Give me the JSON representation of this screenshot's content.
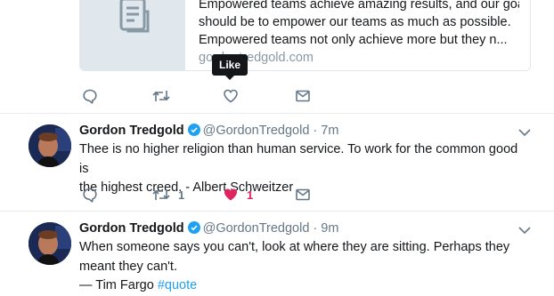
{
  "link_card": {
    "lines": [
      "Empowered teams achieve amazing results, and our goal",
      "should be to empower our teams as much as possible.",
      "Empowered teams not only achieve more but they n..."
    ],
    "domain": "gordontredgold.com",
    "thumb_icon": "document-icon"
  },
  "tooltip": {
    "label": "Like"
  },
  "tweets": [
    {
      "name": "Gordon Tredgold",
      "handle": "@GordonTredgold",
      "dot": "·",
      "time": "7m",
      "lines": [
        "Thee is no higher religion than human service. To work for the common good is",
        "the highest creed. -  Albert Schweitzer"
      ],
      "retweets": "1",
      "likes": "1"
    },
    {
      "name": "Gordon Tredgold",
      "handle": "@GordonTredgold",
      "dot": "·",
      "time": "9m",
      "lines": [
        "When someone says you can't, look at where they are sitting. Perhaps they",
        "meant they can't."
      ],
      "attribution": "— Tim Fargo ",
      "hashtag": "#quote"
    }
  ],
  "colors": {
    "icon_gray": "#657786",
    "like_red": "#e0245e",
    "verified_blue": "#1da1f2",
    "link_blue": "#1da1f2",
    "divider": "#e6ecf0"
  }
}
